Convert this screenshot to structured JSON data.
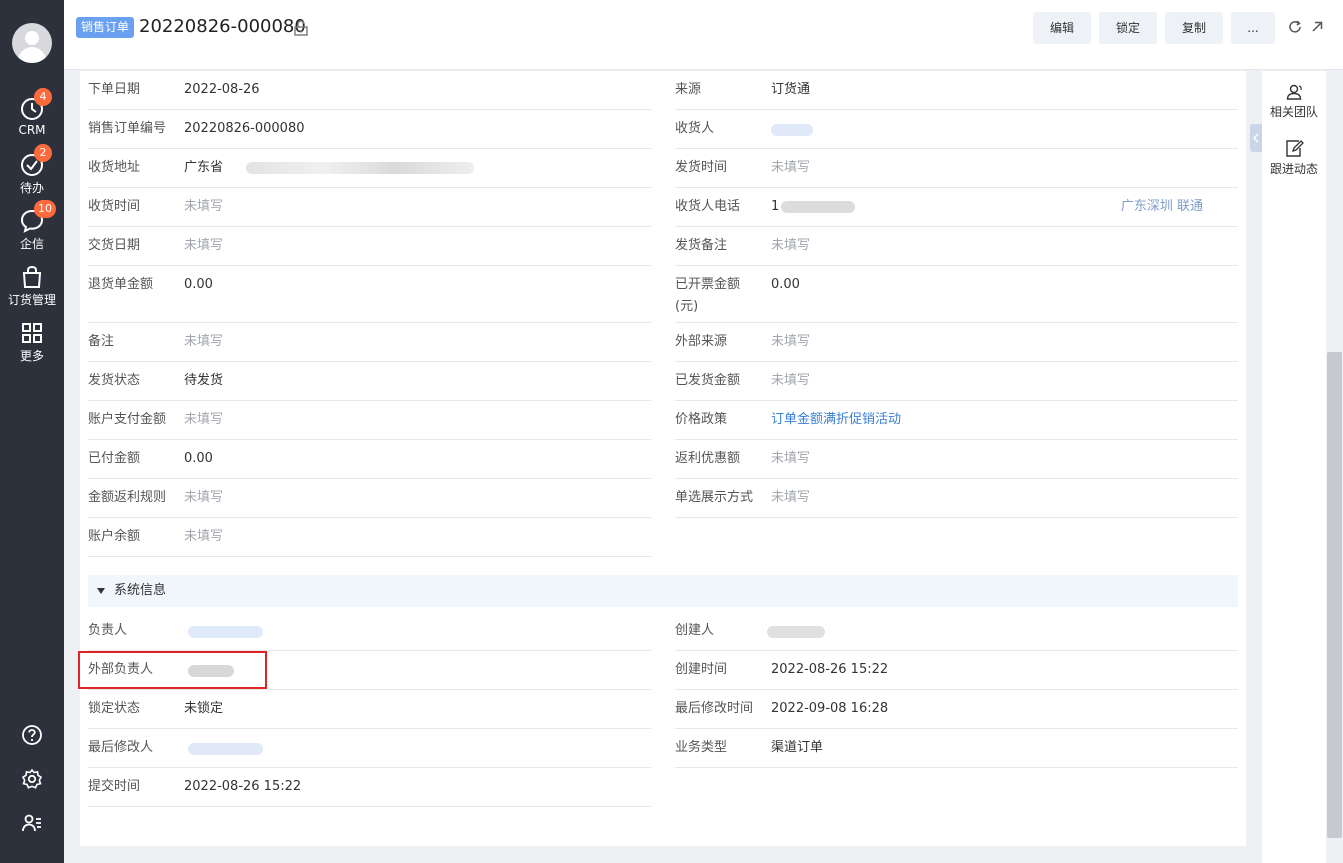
{
  "leftnav": {
    "items": [
      {
        "label": "CRM",
        "badge": "4",
        "icon": "clock-icon"
      },
      {
        "label": "待办",
        "badge": "2",
        "icon": "check-circle-icon"
      },
      {
        "label": "企信",
        "badge": "10",
        "icon": "chat-bubble-icon"
      },
      {
        "label": "订货管理",
        "icon": "shopping-bag-icon"
      },
      {
        "label": "更多",
        "icon": "grid-icon"
      }
    ],
    "bottom_icons": [
      "help-icon",
      "settings-icon",
      "user-list-icon"
    ]
  },
  "header": {
    "object_tag": "销售订单",
    "title": "20220826-000080",
    "buttons": {
      "edit": "编辑",
      "lock": "锁定",
      "copy": "复制",
      "more": "..."
    }
  },
  "detail": {
    "left": [
      {
        "label": "下单日期",
        "value": "2022-08-26"
      },
      {
        "label": "销售订单编号",
        "value": "20220826-000080"
      },
      {
        "label": "收货地址",
        "value": "广东省"
      },
      {
        "label": "收货时间",
        "value": "未填写"
      },
      {
        "label": "交货日期",
        "value": "未填写"
      },
      {
        "label": "退货单金额",
        "value": "0.00"
      },
      {
        "label": "备注",
        "value": "未填写"
      },
      {
        "label": "发货状态",
        "value": "待发货"
      },
      {
        "label": "账户支付金额",
        "value": "未填写"
      },
      {
        "label": "已付金额",
        "value": "0.00"
      },
      {
        "label": "金额返利规则",
        "value": "未填写"
      },
      {
        "label": "账户余额",
        "value": "未填写"
      }
    ],
    "right": [
      {
        "label": "来源",
        "value": "订货通"
      },
      {
        "label": "收货人",
        "value": ""
      },
      {
        "label": "发货时间",
        "value": "未填写"
      },
      {
        "label": "收货人电话",
        "value": "1",
        "extra": "广东深圳 联通"
      },
      {
        "label": "发货备注",
        "value": "未填写"
      },
      {
        "label": "已开票金额",
        "label2": "(元)",
        "value": "0.00"
      },
      {
        "label": "外部来源",
        "value": "未填写"
      },
      {
        "label": "已发货金额",
        "value": "未填写"
      },
      {
        "label": "价格政策",
        "value": "订单金额满折促销活动"
      },
      {
        "label": "返利优惠额",
        "value": "未填写"
      },
      {
        "label": "单选展示方式",
        "value": "未填写"
      }
    ]
  },
  "system": {
    "title": "系统信息",
    "left": [
      {
        "label": "负责人",
        "value": ""
      },
      {
        "label": "外部负责人",
        "value": ""
      },
      {
        "label": "锁定状态",
        "value": "未锁定"
      },
      {
        "label": "最后修改人",
        "value": ""
      },
      {
        "label": "提交时间",
        "value": "2022-08-26 15:22"
      }
    ],
    "right": [
      {
        "label": "创建人",
        "value": ""
      },
      {
        "label": "创建时间",
        "value": "2022-08-26 15:22"
      },
      {
        "label": "最后修改时间",
        "value": "2022-09-08 16:28"
      },
      {
        "label": "业务类型",
        "value": "渠道订单"
      }
    ]
  },
  "rightpanel": {
    "items": [
      {
        "label": "相关团队",
        "icon": "team-icon"
      },
      {
        "label": "跟进动态",
        "icon": "edit-note-icon"
      }
    ]
  },
  "colors": {
    "nav_bg": "#2c313c",
    "badge": "#ff6a3d",
    "link": "#3a7fd6",
    "tag": "#6aa0f0",
    "highlight": "#e02424"
  }
}
